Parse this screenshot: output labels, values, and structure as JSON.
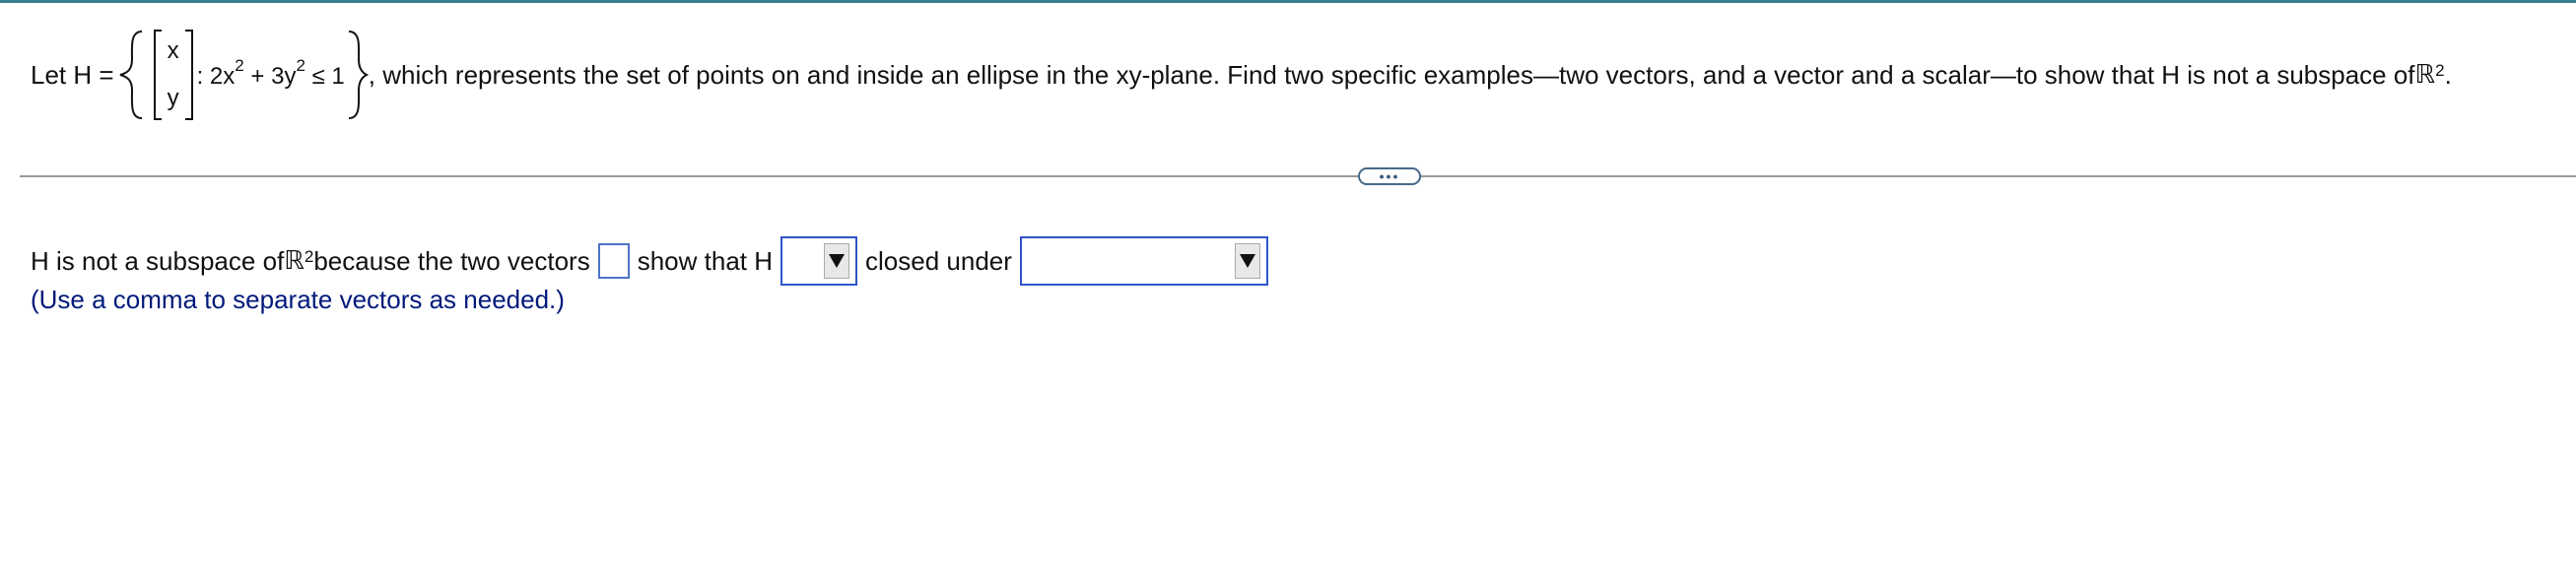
{
  "question": {
    "lead": "Let H =",
    "matrix_top": "x",
    "matrix_bottom": "y",
    "cond_colon": ":",
    "cond_a": "2x",
    "cond_exp1": "2",
    "cond_plus": "+ 3y",
    "cond_exp2": "2",
    "cond_tail": "≤ 1",
    "rest": ", which represents the set of points on and inside an ellipse in the xy-plane. Find two specific examples—two vectors, and a vector and a scalar—to show that H is not a subspace of ",
    "space": "ℝ",
    "space_exp": "2",
    "period": "."
  },
  "more_button": {
    "label": "•••"
  },
  "answer": {
    "part1": "H is not a subspace of ",
    "space": "ℝ",
    "space_exp": "2",
    "part2": " because the two vectors",
    "part3": "show that H",
    "part4": "closed under",
    "vectors_value": "",
    "dropdown1_value": "",
    "dropdown2_value": ""
  },
  "hint": {
    "text": "(Use a comma to separate vectors as needed.)"
  },
  "colors": {
    "top_bar": "#3a7f8f",
    "input_border": "#2e55c9",
    "hint_text": "#001a7a"
  },
  "icons": [
    "left-brace-icon",
    "right-brace-icon",
    "dropdown-arrow-icon"
  ]
}
